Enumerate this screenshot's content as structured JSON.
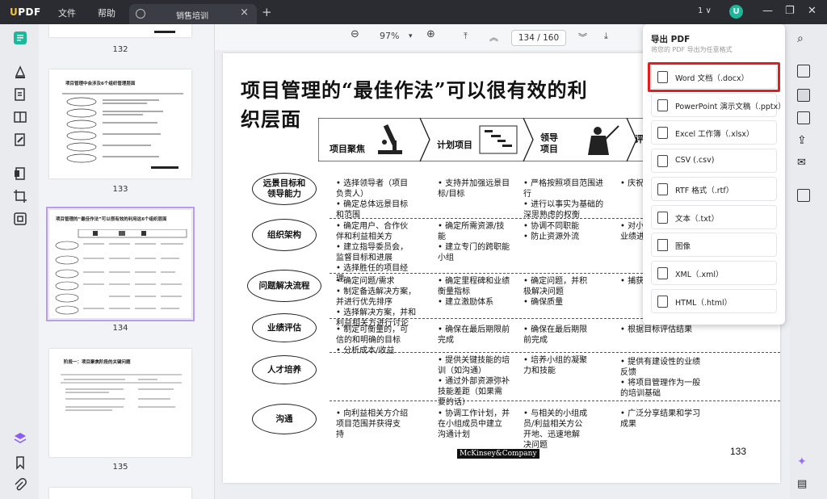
{
  "app": {
    "logo": "UPDF",
    "menus": [
      "文件",
      "帮助"
    ],
    "tab_title": "销售培训",
    "tab_count": "1 ∨",
    "avatar_initial": "U"
  },
  "toolbar": {
    "zoom": "97%",
    "page_current": "134",
    "page_total": "160",
    "page_display": "134 / 160"
  },
  "thumbnails": [
    {
      "label": "132"
    },
    {
      "label": "133",
      "title": "项目管理中会涉及6个组织管理层面"
    },
    {
      "label": "134",
      "title": "项目管理的“最佳作法”可以很有效的利用这6个组织层面"
    },
    {
      "label": "135",
      "title": "阶段一：项目聚焦阶段的关键问题"
    }
  ],
  "export_panel": {
    "title": "导出 PDF",
    "subtitle": "将您的 PDF 导出为任意格式",
    "items": [
      {
        "label": "Word 文档（.docx）",
        "icon": "word-file-icon"
      },
      {
        "label": "PowerPoint 演示文稿（.pptx）",
        "icon": "ppt-file-icon"
      },
      {
        "label": "Excel 工作簿（.xlsx）",
        "icon": "excel-file-icon"
      },
      {
        "label": "CSV (.csv)",
        "icon": "csv-file-icon"
      },
      {
        "label": "RTF 格式（.rtf）",
        "icon": "rtf-file-icon"
      },
      {
        "label": "文本（.txt）",
        "icon": "txt-file-icon"
      },
      {
        "label": "图像",
        "icon": "image-file-icon"
      },
      {
        "label": "XML（.xml）",
        "icon": "xml-file-icon"
      },
      {
        "label": "HTML（.html）",
        "icon": "html-file-icon"
      }
    ]
  },
  "document": {
    "title_line1": "项目管理的“最佳作法”可以很有效的利",
    "title_line2": "织层面",
    "headers": [
      "项目聚焦",
      "计划项目",
      "领导\n项目",
      "评"
    ],
    "rows": [
      {
        "label": "远景目标和\n领导能力",
        "c1": "• 选择领导者（项目\n负责人）\n• 确定总体远景目标\n和范围",
        "c2": "• 支持并加强远景目\n标/目标",
        "c3": "• 严格按照项目范围进\n行\n• 进行以事实为基础的\n深思熟虑的权衡",
        "c4": "• 庆祝成"
      },
      {
        "label": "组织架构",
        "c1": "• 确定用户、合作伙\n伴和利益相关方\n• 建立指导委员会，\n监督目标和进展\n• 选择胜任的项目经\n理",
        "c2": "• 确定所需资源/技\n能\n• 建立专门的跨职能\n小组",
        "c3": "• 协调不同职能\n• 防止资源外流",
        "c4": "• 对小组\n业绩进"
      },
      {
        "label": "问题解决流程",
        "c1": "• 确定问题/需求\n• 制定备选解决方案，\n并进行优先排序\n• 选择解决方案，并和\n利益相关方进行讨论",
        "c2": "• 确定里程碑和业绩\n衡量指标\n• 建立激励体系",
        "c3": "• 确定问题，并积\n极解决问题\n• 确保质量",
        "c4": "• 捕获并"
      },
      {
        "label": "业绩评估",
        "c1": "• 制定可衡量的，可\n信的和明确的目标\n• 分析成本/收益",
        "c2": "• 确保在最后期限前\n完成",
        "c3": "• 确保在最后期限\n前完成",
        "c4": "• 根据目标评估结果"
      },
      {
        "label": "人才培养",
        "c1": "",
        "c2": "• 提供关键技能的培\n训（如沟通）\n• 通过外部资源弥补\n技能差距（如果需\n要的话）",
        "c3": "• 培养小组的凝聚\n力和技能",
        "c4": "• 提供有建设性的业绩\n反馈\n• 将项目管理作为一般\n的培训基础"
      },
      {
        "label": "沟通",
        "c1": "• 向利益相关方介绍\n项目范围并获得支\n持",
        "c2": "• 协调工作计划，并\n在小组成员中建立\n沟通计划",
        "c3": "• 与相关的小组成\n员/利益相关方公\n开地、迅速地解\n决问题",
        "c4": "• 广泛分享结果和学习\n成果"
      }
    ],
    "footer_logo": "McKinsey&Company",
    "page_number": "133"
  }
}
